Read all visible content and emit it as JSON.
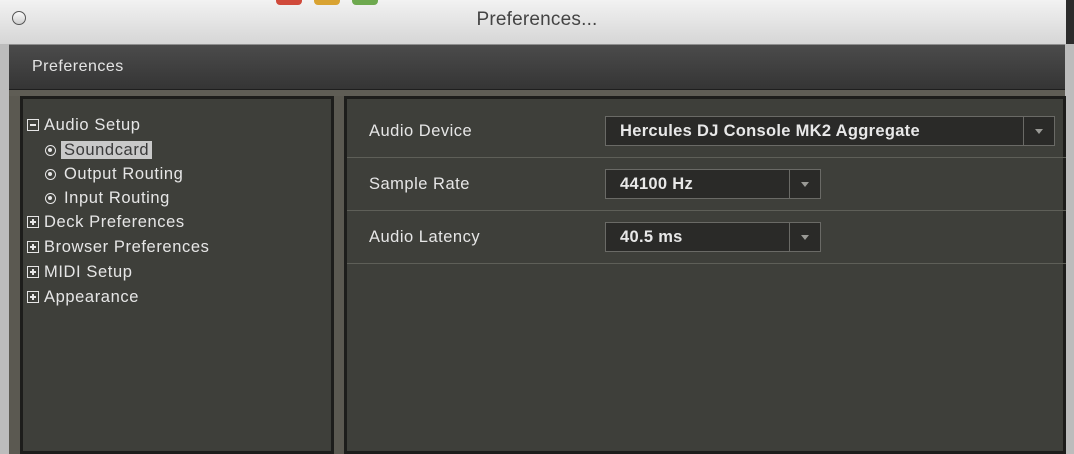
{
  "window": {
    "title": "Preferences..."
  },
  "header": {
    "title": "Preferences"
  },
  "tree": {
    "items": [
      {
        "label": "Audio Setup",
        "type": "group",
        "expanded": true,
        "icon": "minus-box-icon"
      },
      {
        "label": "Soundcard",
        "type": "child",
        "selected": true,
        "icon": "radio-icon"
      },
      {
        "label": "Output Routing",
        "type": "child",
        "icon": "radio-icon"
      },
      {
        "label": "Input Routing",
        "type": "child",
        "icon": "radio-icon"
      },
      {
        "label": "Deck Preferences",
        "type": "group",
        "expanded": false,
        "icon": "plus-box-icon"
      },
      {
        "label": "Browser Preferences",
        "type": "group",
        "expanded": false,
        "icon": "plus-box-icon"
      },
      {
        "label": "MIDI Setup",
        "type": "group",
        "expanded": false,
        "icon": "plus-box-icon"
      },
      {
        "label": "Appearance",
        "type": "group",
        "expanded": false,
        "icon": "plus-box-icon"
      }
    ]
  },
  "settings": {
    "audio_device": {
      "label": "Audio Device",
      "value": "Hercules DJ Console MK2 Aggregate"
    },
    "sample_rate": {
      "label": "Sample Rate",
      "value": "44100 Hz"
    },
    "audio_latency": {
      "label": "Audio Latency",
      "value": "40.5 ms"
    }
  },
  "colors": {
    "panel_bg": "#3e3f3a",
    "window_bg": "#5b5951",
    "header_bg": "#404040",
    "text": "#e6e6e6",
    "selection_bg": "#c9c9c9"
  }
}
